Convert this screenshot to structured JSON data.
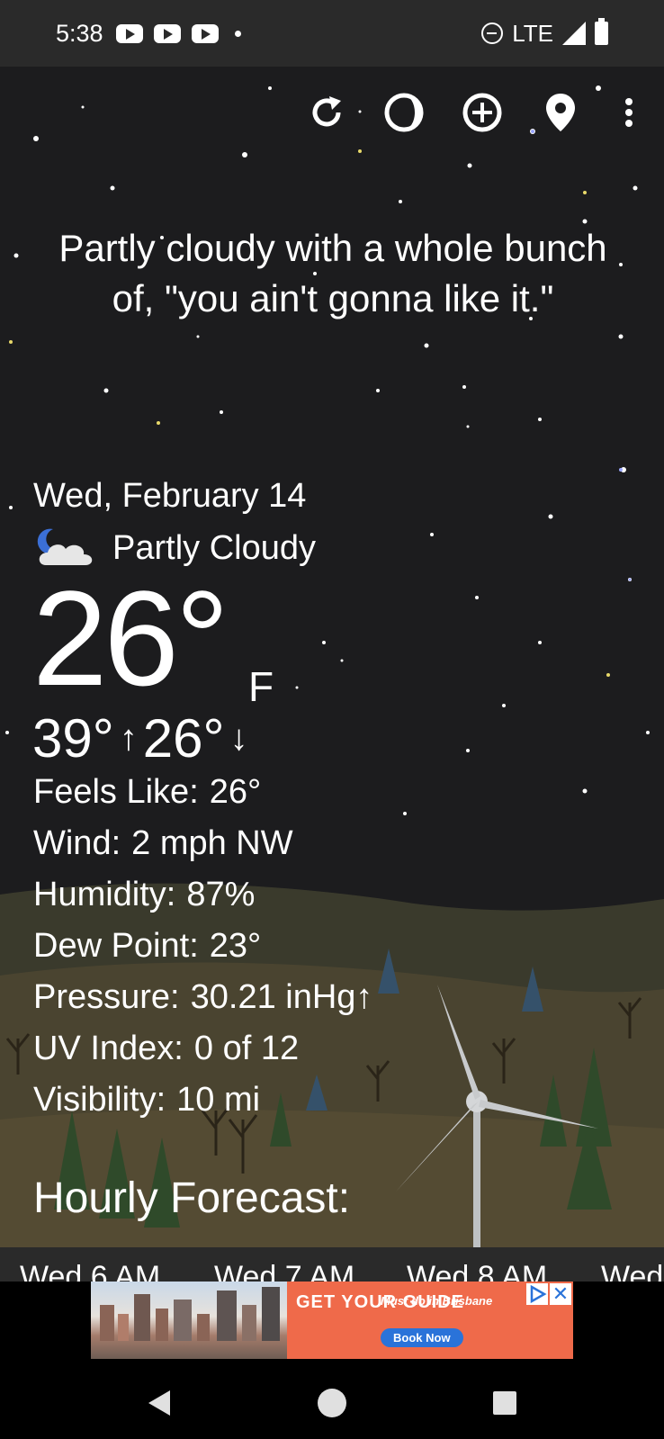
{
  "status_bar": {
    "time": "5:38",
    "network": "LTE",
    "notification_icons": [
      "youtube-icon",
      "youtube-icon",
      "youtube-icon"
    ]
  },
  "toolbar": {
    "icons": [
      "refresh-icon",
      "moon-phase-icon",
      "add-location-icon",
      "location-pin-icon",
      "more-vert-icon"
    ]
  },
  "weather": {
    "headline": "Partly cloudy with a whole bunch of, \"you ain't gonna like it.\"",
    "date": "Wed, February 14",
    "condition": "Partly Cloudy",
    "condition_icon": "partly-cloudy-night-icon",
    "temperature": "26°",
    "unit": "F",
    "high": "39°",
    "low": "26°",
    "details": [
      {
        "label": "Feels Like:",
        "value": "26°"
      },
      {
        "label": "Wind:",
        "value": "2 mph NW"
      },
      {
        "label": "Humidity:",
        "value": "87%"
      },
      {
        "label": "Dew Point:",
        "value": "23°"
      },
      {
        "label": "Pressure:",
        "value": "30.21 inHg↑"
      },
      {
        "label": "UV Index:",
        "value": "0 of 12"
      },
      {
        "label": "Visibility:",
        "value": "10 mi"
      }
    ]
  },
  "hourly": {
    "title": "Hourly Forecast:",
    "items": [
      "Wed 6 AM",
      "Wed 7 AM",
      "Wed 8 AM",
      "Wed"
    ]
  },
  "ad": {
    "cta": "GET YOUR GUIDE",
    "tagline": "Must do in Brisbane",
    "button": "Book Now",
    "close": "✕"
  },
  "colors": {
    "background": "#1c1c1e",
    "status_bar": "#2a2a2a",
    "ad_orange": "#ef6a4a",
    "ad_blue": "#2a73d9"
  }
}
